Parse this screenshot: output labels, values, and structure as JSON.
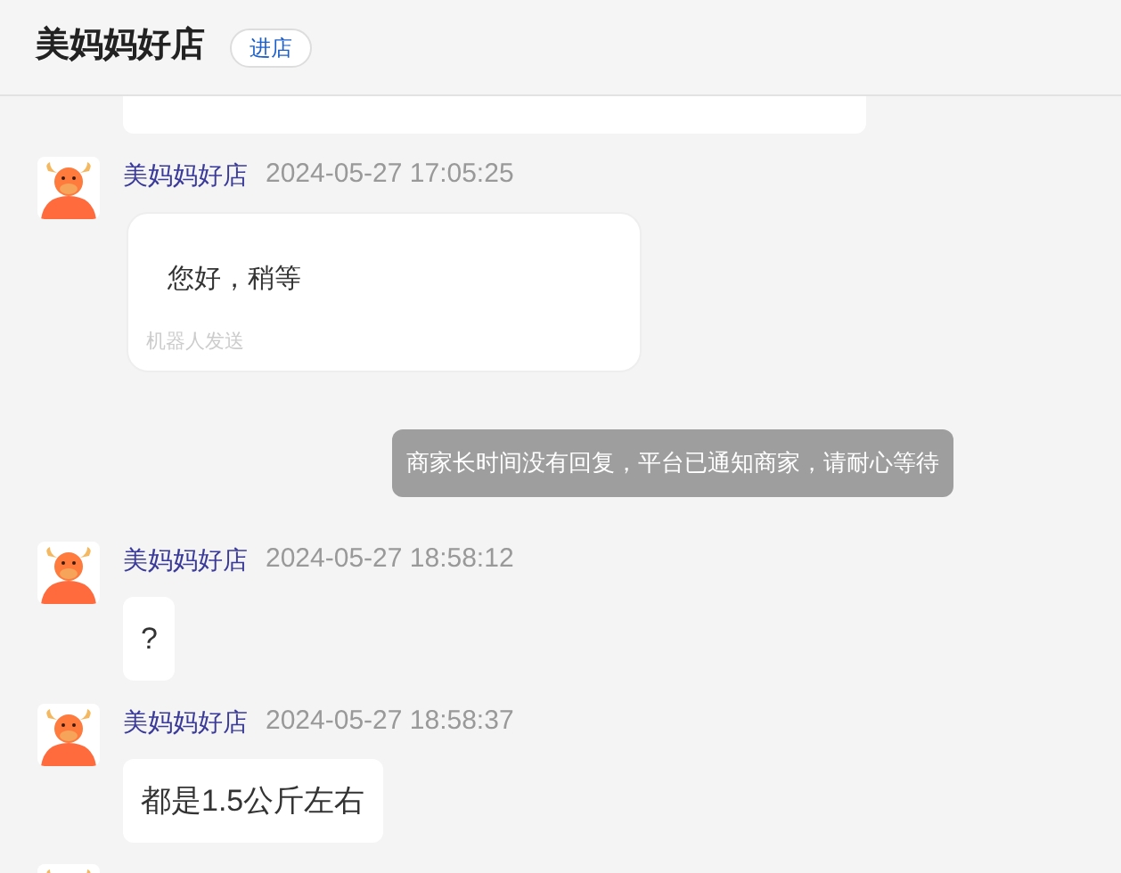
{
  "header": {
    "shop_name": "美妈妈好店",
    "enter_button": "进店"
  },
  "messages": [
    {
      "kind": "shop",
      "sender": "美妈妈好店",
      "time": "2024-05-27 17:05:25",
      "text": "您好，稍等",
      "note": "机器人发送"
    },
    {
      "kind": "system",
      "text": "商家长时间没有回复，平台已通知商家，请耐心等待"
    },
    {
      "kind": "shop",
      "sender": "美妈妈好店",
      "time": "2024-05-27 18:58:12",
      "text": "?"
    },
    {
      "kind": "shop",
      "sender": "美妈妈好店",
      "time": "2024-05-27 18:58:37",
      "text": "都是1.5公斤左右"
    }
  ]
}
